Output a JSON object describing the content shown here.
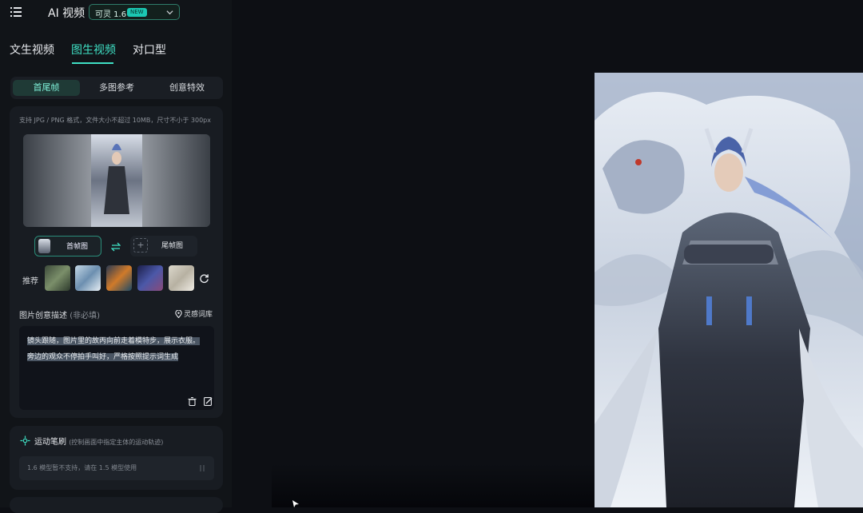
{
  "header": {
    "app_title": "AI 视频",
    "model": {
      "label": "可灵 1.6",
      "badge": "NEW"
    }
  },
  "mode_tabs": [
    {
      "label": "文生视频",
      "active": false
    },
    {
      "label": "图生视频",
      "active": true
    },
    {
      "label": "对口型",
      "active": false
    }
  ],
  "sub_tabs": [
    {
      "label": "首尾帧",
      "active": true
    },
    {
      "label": "多图参考",
      "active": false
    },
    {
      "label": "创意特效",
      "active": false
    }
  ],
  "upload": {
    "hint": "支持 JPG / PNG 格式，文件大小不超过 10MB，尺寸不小于 300px",
    "first_frame_label": "首帧图",
    "last_frame_label": "尾帧图",
    "last_frame_add": "+"
  },
  "recommend": {
    "label": "推荐"
  },
  "description": {
    "title": "图片创意描述",
    "optional": "(非必填)",
    "library_link": "灵感词库",
    "text_line1": "镜头跟随，图片里的故丙向前走着模特步，展示衣服。",
    "text_line2": "旁边的观众不停拍手叫好，严格按照提示词生成"
  },
  "motion_brush": {
    "title": "运动笔刷",
    "subtitle": "(控制画面中指定主体的运动轨迹)",
    "note": "1.6 模型暂不支持，请在 1.5 模型使用"
  },
  "colors": {
    "accent": "#3fe0c4",
    "panel_bg": "#111418",
    "card_bg": "#181c22",
    "page_bg": "#0d0f14"
  }
}
